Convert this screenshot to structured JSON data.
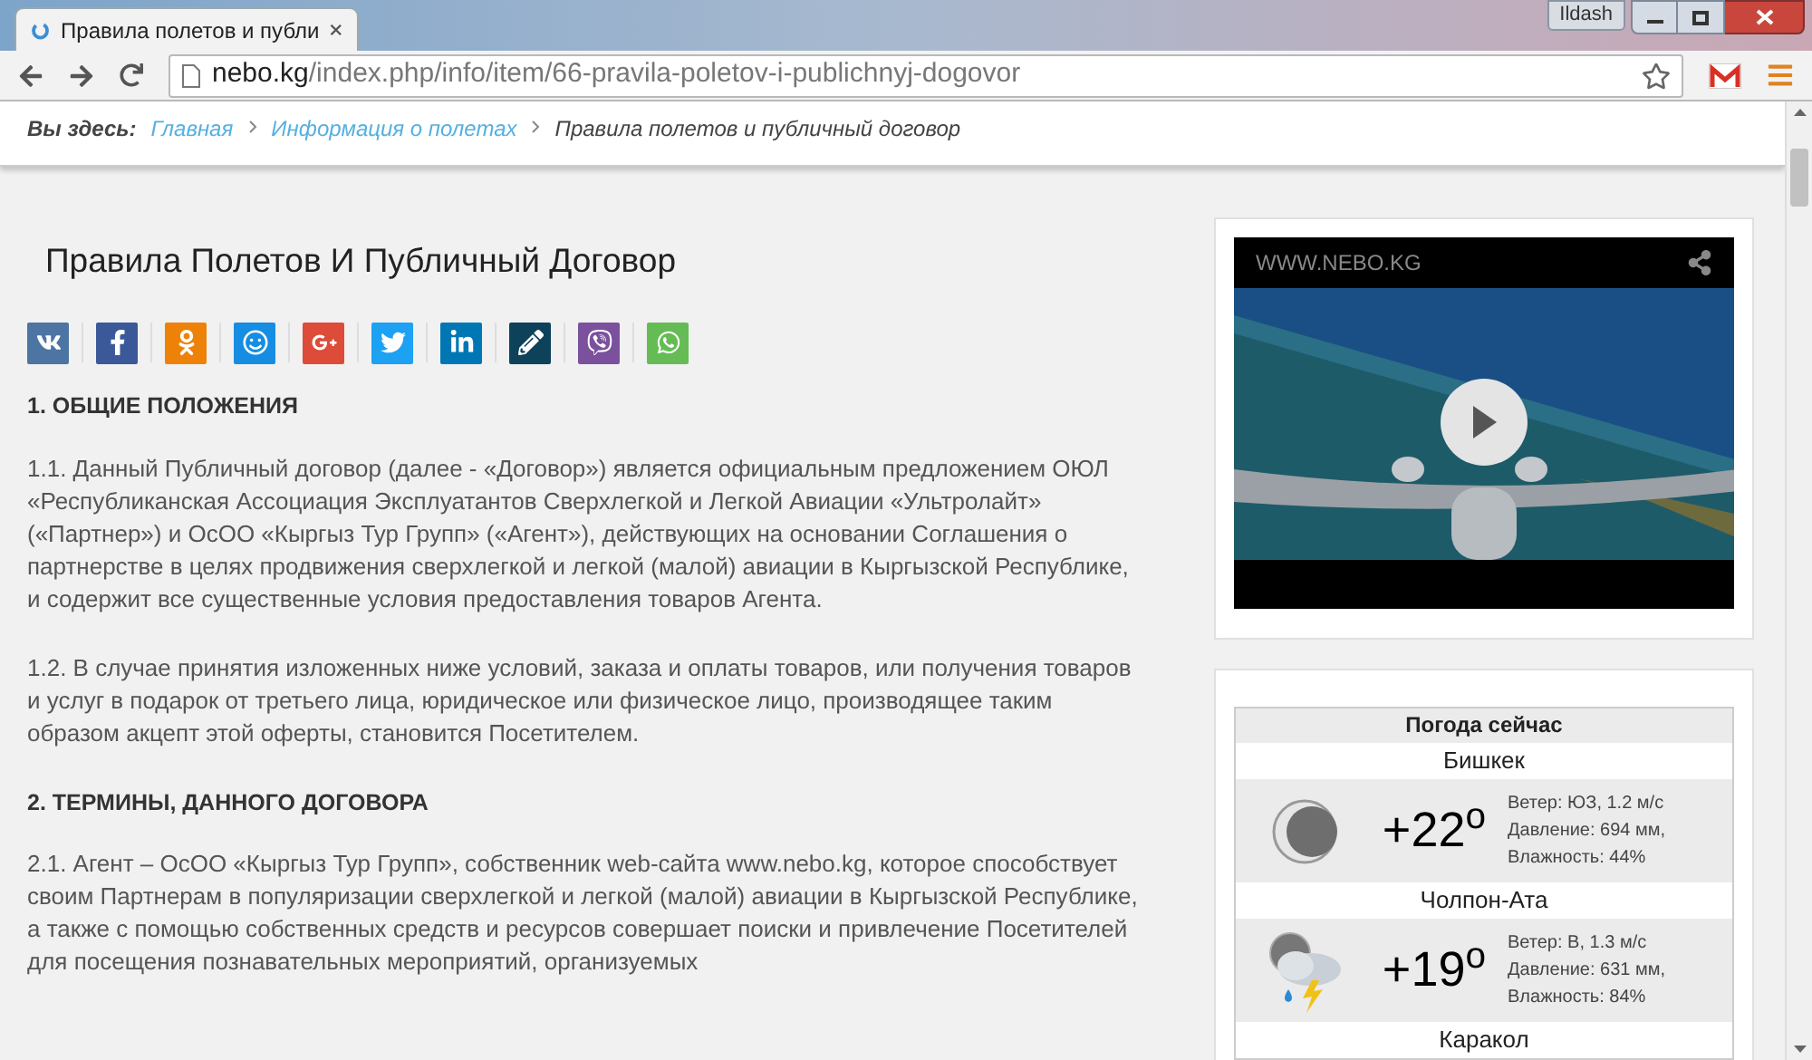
{
  "browser": {
    "tab": {
      "title": "Правила полетов и публи",
      "selected": true
    },
    "profile": "Ildash",
    "url": {
      "host": "nebo.kg",
      "path": "/index.php/info/item/66-pravila-poletov-i-publichnyj-dogovor"
    }
  },
  "breadcrumb": {
    "label": "Вы здесь:",
    "items": [
      {
        "text": "Главная",
        "link": true
      },
      {
        "text": "Информация о полетах",
        "link": true
      },
      {
        "text": "Правила полетов и публичный договор",
        "link": false
      }
    ]
  },
  "article": {
    "title": "Правила Полетов И Публичный Договор",
    "share": [
      {
        "kind": "vk",
        "color": "#4c75a3"
      },
      {
        "kind": "facebook",
        "color": "#3b5998"
      },
      {
        "kind": "odnoklassniki",
        "color": "#ee8208"
      },
      {
        "kind": "mailru",
        "color": "#168de2"
      },
      {
        "kind": "googleplus",
        "color": "#dd4b39"
      },
      {
        "kind": "twitter",
        "color": "#1da1f2"
      },
      {
        "kind": "linkedin",
        "color": "#0077b5"
      },
      {
        "kind": "livejournal",
        "color": "#0d425a"
      },
      {
        "kind": "viber",
        "color": "#7b519d"
      },
      {
        "kind": "whatsapp",
        "color": "#65bc54"
      }
    ],
    "sections": [
      {
        "kind": "heading",
        "text": "1. ОБЩИЕ ПОЛОЖЕНИЯ"
      },
      {
        "kind": "paragraph",
        "text": "1.1. Данный Публичный договор (далее - «Договор») является официальным предложением ОЮЛ «Республиканская Ассоциация Эксплуатантов Сверхлегкой и Легкой Авиации «Ультролайт» («Партнер») и ОсОО «Кыргыз Тур Групп» («Агент»), действующих на основании Соглашения о партнерстве в целях продвижения сверхлегкой и легкой (малой) авиации в Кыргызской Республике, и содержит все существенные условия предоставления товаров Агента."
      },
      {
        "kind": "paragraph",
        "text": "1.2. В случае принятия изложенных ниже условий, заказа и оплаты товаров, или получения товаров и услуг в подарок от третьего лица, юридическое или физическое лицо, производящее таким образом акцепт этой оферты, становится Посетителем."
      },
      {
        "kind": "heading",
        "text": "2. ТЕРМИНЫ, ДАННОГО ДОГОВОРА"
      },
      {
        "kind": "paragraph",
        "text": "2.1. Агент – ОсОО «Кыргыз Тур Групп», собственник web-сайта www.nebo.kg, которое способствует своим Партнерам в популяризации сверхлегкой и легкой (малой) авиации в Кыргызской Республике, а также с помощью собственных средств и ресурсов совершает поиски и привлечение Посетителей для посещения познавательных мероприятий, организуемых"
      }
    ]
  },
  "video": {
    "watermark": "WWW.NEBO.KG"
  },
  "weather": {
    "title": "Погода сейчас",
    "cities": [
      {
        "name": "Бишкек",
        "kind": "moon",
        "temp": "+22$^{o}$",
        "details": [
          "Ветер: ЮЗ, 1.2 м/с",
          "Давление: 694 мм,",
          "Влажность: 44%"
        ]
      },
      {
        "name": "Чолпон-Ата",
        "kind": "storm",
        "temp": "+19$^{o}$",
        "details": [
          "Ветер: В, 1.3 м/с",
          "Давление: 631 мм,",
          "Влажность: 84%"
        ]
      },
      {
        "name": "Каракол"
      }
    ]
  }
}
